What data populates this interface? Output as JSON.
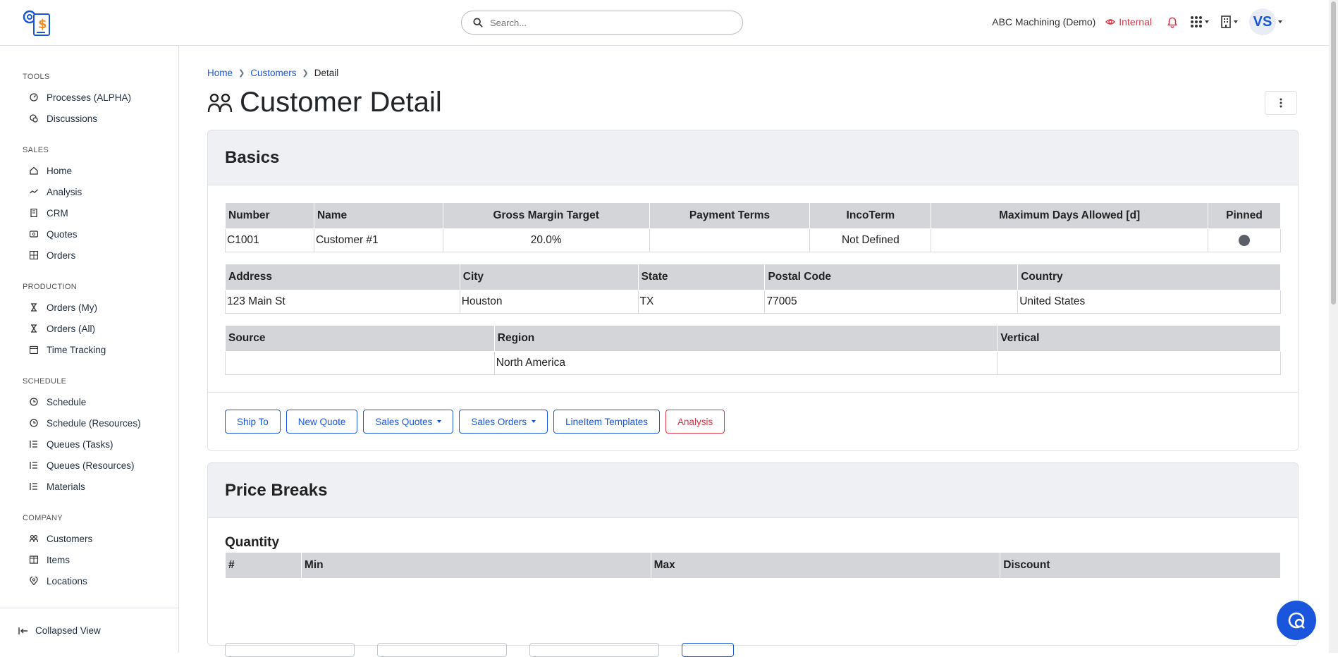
{
  "header": {
    "search_placeholder": "Search...",
    "company_name": "ABC Machining (Demo)",
    "visibility_label": "Internal",
    "avatar_initials": "VS"
  },
  "sidebar": {
    "sections": [
      {
        "title": "TOOLS",
        "items": [
          {
            "label": "Processes (ALPHA)",
            "icon": "gauge-icon"
          },
          {
            "label": "Discussions",
            "icon": "chat-icon"
          }
        ]
      },
      {
        "title": "SALES",
        "items": [
          {
            "label": "Home",
            "icon": "home-icon"
          },
          {
            "label": "Analysis",
            "icon": "trend-icon"
          },
          {
            "label": "CRM",
            "icon": "building-icon"
          },
          {
            "label": "Quotes",
            "icon": "dollar-icon"
          },
          {
            "label": "Orders",
            "icon": "grid-icon"
          }
        ]
      },
      {
        "title": "PRODUCTION",
        "items": [
          {
            "label": "Orders (My)",
            "icon": "hourglass-icon"
          },
          {
            "label": "Orders (All)",
            "icon": "hourglass-icon"
          },
          {
            "label": "Time Tracking",
            "icon": "calendar-icon"
          }
        ]
      },
      {
        "title": "SCHEDULE",
        "items": [
          {
            "label": "Schedule",
            "icon": "clock-icon"
          },
          {
            "label": "Schedule (Resources)",
            "icon": "clock-icon"
          },
          {
            "label": "Queues (Tasks)",
            "icon": "list-icon"
          },
          {
            "label": "Queues (Resources)",
            "icon": "list-icon"
          },
          {
            "label": "Materials",
            "icon": "list-icon"
          }
        ]
      },
      {
        "title": "COMPANY",
        "items": [
          {
            "label": "Customers",
            "icon": "users-icon"
          },
          {
            "label": "Items",
            "icon": "box-icon"
          },
          {
            "label": "Locations",
            "icon": "pin-icon"
          }
        ]
      }
    ],
    "collapse_label": "Collapsed View"
  },
  "breadcrumb": {
    "home": "Home",
    "customers": "Customers",
    "current": "Detail"
  },
  "page_title": "Customer Detail",
  "basics": {
    "title": "Basics",
    "table1": {
      "headers": [
        "Number",
        "Name",
        "Gross Margin Target",
        "Payment Terms",
        "IncoTerm",
        "Maximum Days Allowed [d]",
        "Pinned"
      ],
      "row": [
        "C1001",
        "Customer #1",
        "20.0%",
        "",
        "Not Defined",
        "",
        ""
      ]
    },
    "table2": {
      "headers": [
        "Address",
        "City",
        "State",
        "Postal Code",
        "Country"
      ],
      "row": [
        "123 Main St",
        "Houston",
        "TX",
        "77005",
        "United States"
      ]
    },
    "table3": {
      "headers": [
        "Source",
        "Region",
        "Vertical"
      ],
      "row": [
        "",
        "North America",
        ""
      ]
    },
    "buttons": {
      "ship_to": "Ship To",
      "new_quote": "New Quote",
      "sales_quotes": "Sales Quotes",
      "sales_orders": "Sales Orders",
      "lineitem_templates": "LineItem Templates",
      "analysis": "Analysis"
    }
  },
  "price_breaks": {
    "title": "Price Breaks",
    "subtitle": "Quantity",
    "headers": [
      "#",
      "Min",
      "Max",
      "Discount"
    ]
  }
}
